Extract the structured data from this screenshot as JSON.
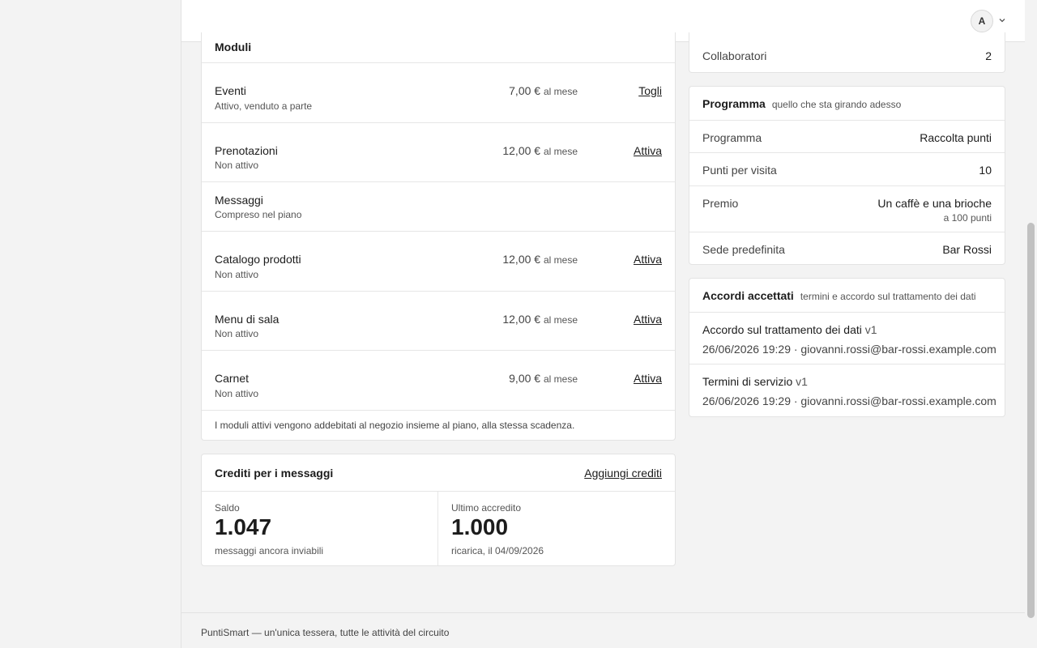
{
  "header": {
    "avatar_initial": "A"
  },
  "modules": {
    "title": "Moduli",
    "items": [
      {
        "name": "Eventi",
        "status": "Attivo, venduto a parte",
        "price": "7,00 €",
        "unit": "al mese",
        "action": "Togli"
      },
      {
        "name": "Prenotazioni",
        "status": "Non attivo",
        "price": "12,00 €",
        "unit": "al mese",
        "action": "Attiva"
      },
      {
        "name": "Messaggi",
        "status": "Compreso nel piano",
        "price": "",
        "unit": "",
        "action": ""
      },
      {
        "name": "Catalogo prodotti",
        "status": "Non attivo",
        "price": "12,00 €",
        "unit": "al mese",
        "action": "Attiva"
      },
      {
        "name": "Menu di sala",
        "status": "Non attivo",
        "price": "12,00 €",
        "unit": "al mese",
        "action": "Attiva"
      },
      {
        "name": "Carnet",
        "status": "Non attivo",
        "price": "9,00 €",
        "unit": "al mese",
        "action": "Attiva"
      }
    ],
    "note": "I moduli attivi vengono addebitati al negozio insieme al piano, alla stessa scadenza."
  },
  "credits": {
    "title": "Crediti per i messaggi",
    "add_label": "Aggiungi crediti",
    "balance_label": "Saldo",
    "balance_value": "1.047",
    "balance_sub": "messaggi ancora inviabili",
    "last_label": "Ultimo accredito",
    "last_value": "1.000",
    "last_sub": "ricarica, il 04/09/2026"
  },
  "collaborators": {
    "label": "Collaboratori",
    "value": "2"
  },
  "programma": {
    "title": "Programma",
    "subtitle": "quello che sta girando adesso",
    "rows": [
      {
        "label": "Programma",
        "value": "Raccolta punti"
      },
      {
        "label": "Punti per visita",
        "value": "10"
      },
      {
        "label": "Premio",
        "value": "Un caffè e una brioche",
        "sub": "a 100 punti"
      },
      {
        "label": "Sede predefinita",
        "value": "Bar Rossi"
      }
    ]
  },
  "accordi": {
    "title": "Accordi accettati",
    "subtitle": "termini e accordo sul trattamento dei dati",
    "items": [
      {
        "title": "Accordo sul trattamento dei dati",
        "version": "v1",
        "meta": "26/06/2026 19:29 · giovanni.rossi@bar-rossi.example.com"
      },
      {
        "title": "Termini di servizio",
        "version": "v1",
        "meta": "26/06/2026 19:29 · giovanni.rossi@bar-rossi.example.com"
      }
    ]
  },
  "footer": {
    "text": "PuntiSmart — un'unica tessera, tutte le attività del circuito"
  }
}
